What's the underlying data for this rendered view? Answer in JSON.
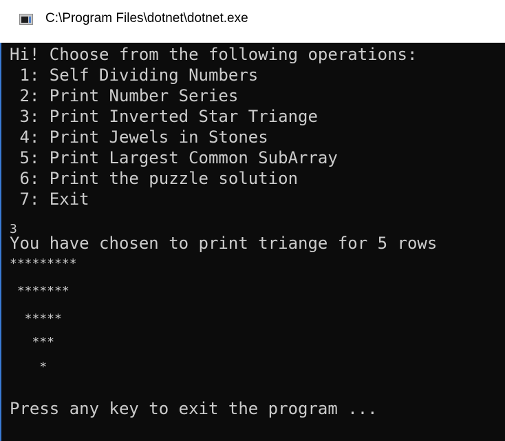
{
  "window": {
    "title": "C:\\Program Files\\dotnet\\dotnet.exe"
  },
  "console": {
    "lines": [
      "Hi! Choose from the following operations:",
      " 1: Self Dividing Numbers",
      " 2: Print Number Series",
      " 3: Print Inverted Star Triange",
      " 4: Print Jewels in Stones",
      " 5: Print Largest Common SubArray",
      " 6: Print the puzzle solution",
      " 7: Exit",
      "3",
      "You have chosen to print triange for 5 rows",
      "*********",
      " *******",
      "  *****",
      "   ***",
      "    *",
      "",
      "Press any key to exit the program ..."
    ]
  }
}
